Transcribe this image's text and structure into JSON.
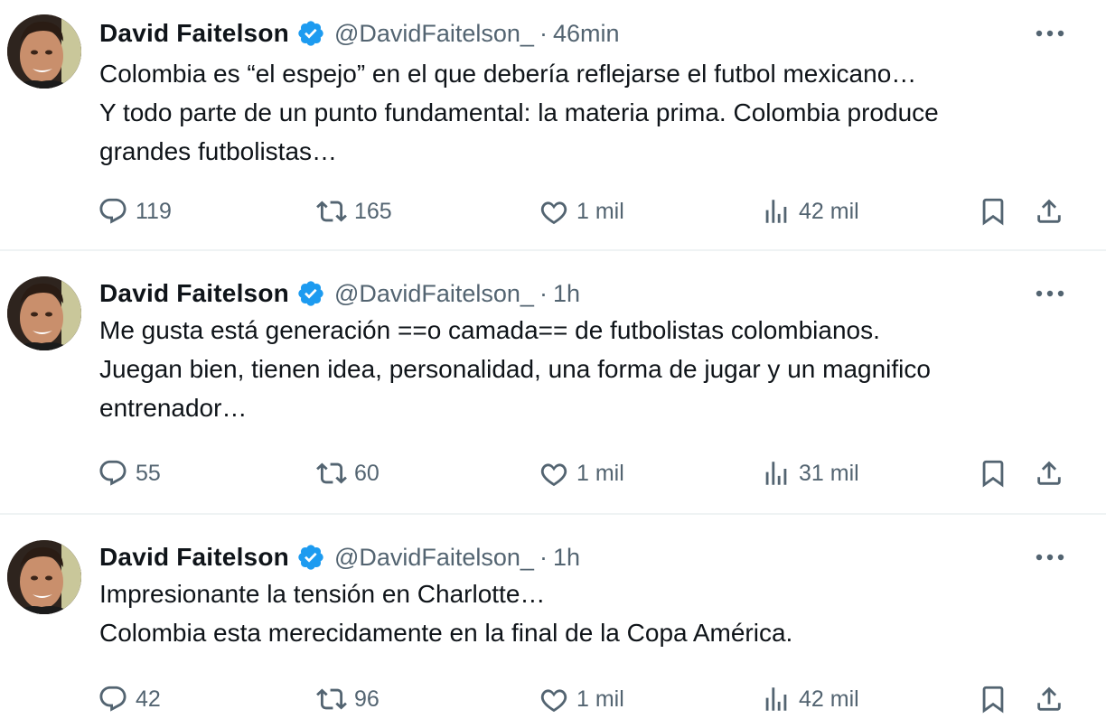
{
  "tweets": [
    {
      "author": "David Faitelson",
      "handle": "@DavidFaitelson_",
      "separator": "·",
      "time": "46min",
      "lines": [
        "Colombia es “el espejo” en el que debería reflejarse el futbol mexicano…",
        "Y todo parte de un punto fundamental: la materia prima. Colombia produce",
        "grandes futbolistas…"
      ],
      "replies": "119",
      "retweets": "165",
      "likes": "1 mil",
      "views": "42 mil"
    },
    {
      "author": "David Faitelson",
      "handle": "@DavidFaitelson_",
      "separator": "·",
      "time": "1h",
      "lines": [
        "Me gusta está generación ==o camada== de futbolistas colombianos.",
        "Juegan bien, tienen idea, personalidad, una forma de jugar y un magnifico",
        "entrenador…"
      ],
      "replies": "55",
      "retweets": "60",
      "likes": "1 mil",
      "views": "31 mil"
    },
    {
      "author": "David Faitelson",
      "handle": "@DavidFaitelson_",
      "separator": "·",
      "time": "1h",
      "lines": [
        "Impresionante la tensión en Charlotte…",
        "Colombia esta merecidamente en la final de la Copa América."
      ],
      "replies": "42",
      "retweets": "96",
      "likes": "1 mil",
      "views": "42 mil"
    }
  ],
  "icons": {
    "verified": "verified-badge-icon",
    "more": "more-dots-icon",
    "reply": "reply-bubble-icon",
    "retweet": "retweet-icon",
    "like": "heart-icon",
    "views": "views-bars-icon",
    "bookmark": "bookmark-icon",
    "share": "share-upload-icon"
  },
  "colors": {
    "verified": "#1d9bf0",
    "secondary_text": "#536471",
    "primary_text": "#0f1419",
    "divider": "#eff3f4"
  }
}
